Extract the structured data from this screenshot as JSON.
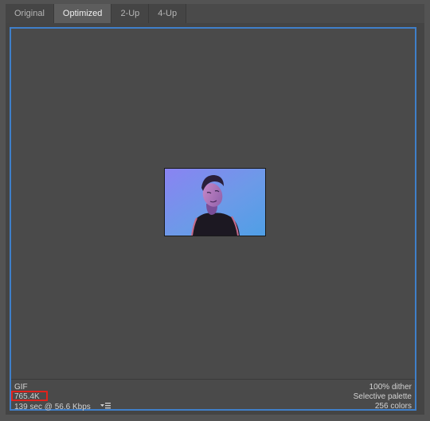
{
  "tabs": [
    {
      "label": "Original",
      "active": false
    },
    {
      "label": "Optimized",
      "active": true
    },
    {
      "label": "2-Up",
      "active": false
    },
    {
      "label": "4-Up",
      "active": false
    }
  ],
  "preview": {
    "description_icon": "image-preview"
  },
  "info": {
    "format": "GIF",
    "file_size": "765.4K",
    "download_time": "139 sec @ 56.6 Kbps",
    "dither": "100% dither",
    "palette": "Selective palette",
    "colors": "256 colors"
  },
  "colors": {
    "selection_border": "#3f7fc9",
    "highlight_box": "#e0231c"
  }
}
